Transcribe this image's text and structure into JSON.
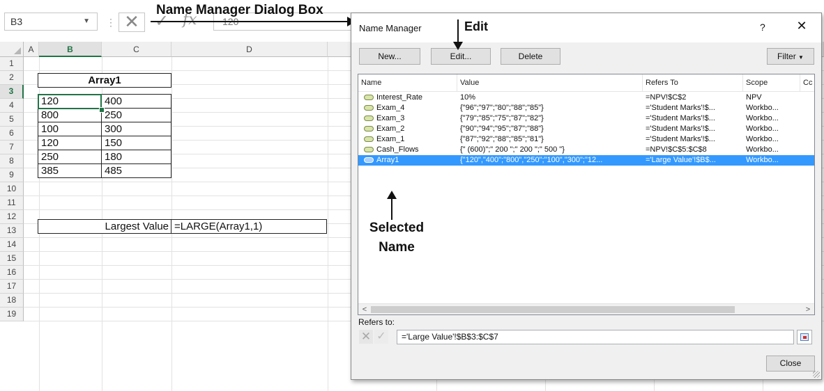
{
  "formula_bar": {
    "name_box": "B3",
    "content": "120"
  },
  "sheet": {
    "columns": [
      "A",
      "B",
      "C",
      "D"
    ],
    "rows": [
      "1",
      "2",
      "3",
      "4",
      "5",
      "6",
      "7",
      "8",
      "9",
      "10",
      "11",
      "12",
      "13",
      "14",
      "15",
      "16",
      "17",
      "18",
      "19"
    ],
    "array_title": "Array1",
    "array_rows": [
      [
        "120",
        "400"
      ],
      [
        "800",
        "250"
      ],
      [
        "100",
        "300"
      ],
      [
        "120",
        "150"
      ],
      [
        "250",
        "180"
      ],
      [
        "385",
        "485"
      ]
    ],
    "largest_label": "Largest Value",
    "largest_formula": "=LARGE(Array1,1)"
  },
  "annotations": {
    "dialog_label": "Name Manager Dialog Box",
    "edit_label": "Edit",
    "selected_name_label_1": "Selected",
    "selected_name_label_2": "Name"
  },
  "dialog": {
    "title": "Name Manager",
    "help": "?",
    "close_glyph": "✕",
    "buttons": {
      "new": "New...",
      "edit": "Edit...",
      "delete": "Delete",
      "filter": "Filter"
    },
    "columns": [
      "Name",
      "Value",
      "Refers To",
      "Scope",
      "Cc"
    ],
    "names": [
      {
        "name": "Interest_Rate",
        "value": "10%",
        "refers_to": "=NPV!$C$2",
        "scope": "NPV"
      },
      {
        "name": "Exam_4",
        "value": "{\"96\";\"97\";\"80\";\"88\";\"85\"}",
        "refers_to": "='Student Marks'!$...",
        "scope": "Workbo..."
      },
      {
        "name": "Exam_3",
        "value": "{\"79\";\"85\";\"75\";\"87\";\"82\"}",
        "refers_to": "='Student Marks'!$...",
        "scope": "Workbo..."
      },
      {
        "name": "Exam_2",
        "value": "{\"90\";\"94\";\"95\";\"87\";\"88\"}",
        "refers_to": "='Student Marks'!$...",
        "scope": "Workbo..."
      },
      {
        "name": "Exam_1",
        "value": "{\"87\";\"92\";\"88\";\"85\";\"81\"}",
        "refers_to": "='Student Marks'!$...",
        "scope": "Workbo..."
      },
      {
        "name": "Cash_Flows",
        "value": "{\" (600)\";\" 200 \";\" 200 \";\" 500 \"}",
        "refers_to": "=NPV!$C$5:$C$8",
        "scope": "Workbo..."
      },
      {
        "name": "Array1",
        "value": "{\"120\",\"400\";\"800\",\"250\";\"100\",\"300\";\"12...",
        "refers_to": "='Large Value'!$B$...",
        "scope": "Workbo..."
      }
    ],
    "selected_index": 6,
    "refers_to_label": "Refers to:",
    "refers_to_value": "='Large Value'!$B$3:$C$7",
    "close_button": "Close"
  },
  "colors": {
    "excel_green": "#217346",
    "selection_blue": "#3399ff"
  }
}
